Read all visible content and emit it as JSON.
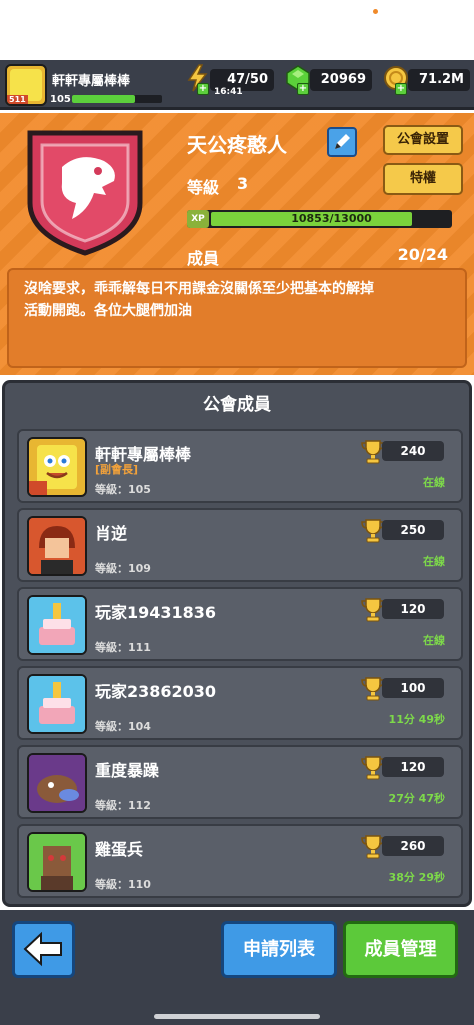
{
  "player": {
    "name": "軒軒專屬棒棒",
    "level": "105",
    "badge": "511",
    "xp_fraction": 0.7
  },
  "resources": {
    "energy": "47/50",
    "timer": "16:41",
    "gems": "20969",
    "coins": "71.2M"
  },
  "guild": {
    "name": "天公疼憨人",
    "settings_label": "公會設置",
    "privilege_label": "特權",
    "level_label": "等級",
    "level_value": "3",
    "xp_badge": "XP",
    "xp_text": "10853/13000",
    "xp_fraction": 0.835,
    "members_label": "成員",
    "members_value": "20/24",
    "description_line1": "沒啥要求，乖乖解每日不用課金沒關係至少把基本的解掉",
    "description_line2": "活動開跑。各位大腿們加油"
  },
  "members_panel": {
    "title": "公會成員",
    "members": [
      {
        "name": "軒軒專屬棒棒",
        "role": "[副會長]",
        "level": "等級：105",
        "trophies": "240",
        "status": "在線",
        "avatar": "sponge-avatar",
        "badge": "511"
      },
      {
        "name": "肖逆",
        "role": "",
        "level": "等級：109",
        "trophies": "250",
        "status": "在線",
        "avatar": "red-hair-avatar"
      },
      {
        "name": "玩家19431836",
        "role": "",
        "level": "等級：111",
        "trophies": "120",
        "status": "在線",
        "avatar": "cake-avatar"
      },
      {
        "name": "玩家23862030",
        "role": "",
        "level": "等級：104",
        "trophies": "100",
        "status": "11分 49秒",
        "avatar": "cake-avatar"
      },
      {
        "name": "重度暴躁",
        "role": "",
        "level": "等級：112",
        "trophies": "120",
        "status": "27分 47秒",
        "avatar": "purple-creature-avatar"
      },
      {
        "name": "雞蛋兵",
        "role": "",
        "level": "等級：110",
        "trophies": "260",
        "status": "38分 29秒",
        "avatar": "box-head-avatar"
      }
    ]
  },
  "bottom": {
    "apply_list_label": "申請列表",
    "manage_members_label": "成員管理"
  },
  "colors": {
    "accent_orange": "#f28b2c",
    "panel_gray": "#4b505a",
    "online_green": "#7dd94a",
    "role_orange": "#f3a23a"
  }
}
